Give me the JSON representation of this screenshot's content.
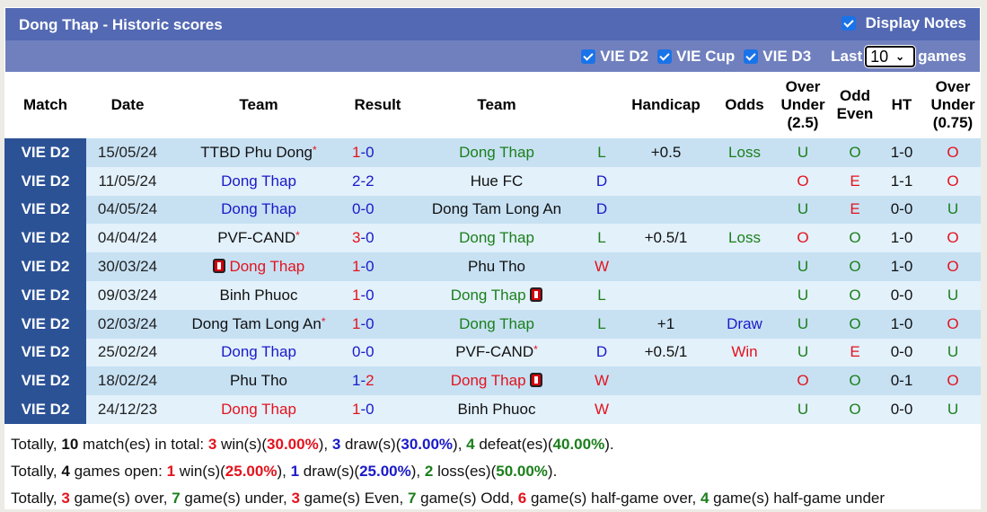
{
  "header": {
    "title": "Dong Thap - Historic scores",
    "display_notes_label": "Display Notes",
    "display_notes_checked": true
  },
  "filters": {
    "items": [
      {
        "label": "VIE D2",
        "checked": true
      },
      {
        "label": "VIE Cup",
        "checked": true
      },
      {
        "label": "VIE D3",
        "checked": true
      }
    ],
    "last_label": "Last",
    "games_count": "10",
    "games_label": "games"
  },
  "table": {
    "columns": [
      "Match",
      "Date",
      "Team",
      "Result",
      "Team",
      "",
      "Handicap",
      "Odds",
      "Over Under (2.5)",
      "Odd Even",
      "HT",
      "Over Under (0.75)"
    ],
    "column_lines": {
      "ou25": [
        "Over",
        "Under",
        "(2.5)"
      ],
      "oe": [
        "Odd",
        "Even"
      ],
      "ou075": [
        "Over",
        "Under",
        "(0.75)"
      ]
    },
    "rows": [
      {
        "match": "VIE D2",
        "date": "15/05/24",
        "home": "TTBD Phu Dong",
        "home_color": "dark",
        "home_star": true,
        "home_card": false,
        "score_home": "1",
        "score_away": "0",
        "sh_color": "red",
        "sa_color": "blue",
        "away": "Dong Thap",
        "away_color": "green",
        "away_star": false,
        "away_card": false,
        "wl": "L",
        "wl_color": "green",
        "handicap": "+0.5",
        "odds": "Loss",
        "odds_color": "green",
        "ou": "U",
        "ou_color": "green",
        "oe": "O",
        "oe_color": "green",
        "ht": "1-0",
        "ou075": "O",
        "ou075_color": "red"
      },
      {
        "match": "VIE D2",
        "date": "11/05/24",
        "home": "Dong Thap",
        "home_color": "blue",
        "home_star": false,
        "home_card": false,
        "score_home": "2",
        "score_away": "2",
        "sh_color": "blue",
        "sa_color": "blue",
        "away": "Hue FC",
        "away_color": "dark",
        "away_star": false,
        "away_card": false,
        "wl": "D",
        "wl_color": "blue",
        "handicap": "",
        "odds": "",
        "odds_color": "dark",
        "ou": "O",
        "ou_color": "red",
        "oe": "E",
        "oe_color": "red",
        "ht": "1-1",
        "ou075": "O",
        "ou075_color": "red"
      },
      {
        "match": "VIE D2",
        "date": "04/05/24",
        "home": "Dong Thap",
        "home_color": "blue",
        "home_star": false,
        "home_card": false,
        "score_home": "0",
        "score_away": "0",
        "sh_color": "blue",
        "sa_color": "blue",
        "away": "Dong Tam Long An",
        "away_color": "dark",
        "away_star": false,
        "away_card": false,
        "wl": "D",
        "wl_color": "blue",
        "handicap": "",
        "odds": "",
        "odds_color": "dark",
        "ou": "U",
        "ou_color": "green",
        "oe": "E",
        "oe_color": "red",
        "ht": "0-0",
        "ou075": "U",
        "ou075_color": "green"
      },
      {
        "match": "VIE D2",
        "date": "04/04/24",
        "home": "PVF-CAND",
        "home_color": "dark",
        "home_star": true,
        "home_card": false,
        "score_home": "3",
        "score_away": "0",
        "sh_color": "red",
        "sa_color": "blue",
        "away": "Dong Thap",
        "away_color": "green",
        "away_star": false,
        "away_card": false,
        "wl": "L",
        "wl_color": "green",
        "handicap": "+0.5/1",
        "odds": "Loss",
        "odds_color": "green",
        "ou": "O",
        "ou_color": "red",
        "oe": "O",
        "oe_color": "green",
        "ht": "1-0",
        "ou075": "O",
        "ou075_color": "red"
      },
      {
        "match": "VIE D2",
        "date": "30/03/24",
        "home": "Dong Thap",
        "home_color": "red",
        "home_star": false,
        "home_card": true,
        "score_home": "1",
        "score_away": "0",
        "sh_color": "red",
        "sa_color": "blue",
        "away": "Phu Tho",
        "away_color": "dark",
        "away_star": false,
        "away_card": false,
        "wl": "W",
        "wl_color": "red",
        "handicap": "",
        "odds": "",
        "odds_color": "dark",
        "ou": "U",
        "ou_color": "green",
        "oe": "O",
        "oe_color": "green",
        "ht": "1-0",
        "ou075": "O",
        "ou075_color": "red"
      },
      {
        "match": "VIE D2",
        "date": "09/03/24",
        "home": "Binh Phuoc",
        "home_color": "dark",
        "home_star": false,
        "home_card": false,
        "score_home": "1",
        "score_away": "0",
        "sh_color": "red",
        "sa_color": "blue",
        "away": "Dong Thap",
        "away_color": "green",
        "away_star": false,
        "away_card": true,
        "wl": "L",
        "wl_color": "green",
        "handicap": "",
        "odds": "",
        "odds_color": "dark",
        "ou": "U",
        "ou_color": "green",
        "oe": "O",
        "oe_color": "green",
        "ht": "0-0",
        "ou075": "U",
        "ou075_color": "green"
      },
      {
        "match": "VIE D2",
        "date": "02/03/24",
        "home": "Dong Tam Long An",
        "home_color": "dark",
        "home_star": true,
        "home_card": false,
        "score_home": "1",
        "score_away": "0",
        "sh_color": "red",
        "sa_color": "blue",
        "away": "Dong Thap",
        "away_color": "green",
        "away_star": false,
        "away_card": false,
        "wl": "L",
        "wl_color": "green",
        "handicap": "+1",
        "odds": "Draw",
        "odds_color": "blue",
        "ou": "U",
        "ou_color": "green",
        "oe": "O",
        "oe_color": "green",
        "ht": "1-0",
        "ou075": "O",
        "ou075_color": "red"
      },
      {
        "match": "VIE D2",
        "date": "25/02/24",
        "home": "Dong Thap",
        "home_color": "blue",
        "home_star": false,
        "home_card": false,
        "score_home": "0",
        "score_away": "0",
        "sh_color": "blue",
        "sa_color": "blue",
        "away": "PVF-CAND",
        "away_color": "dark",
        "away_star": true,
        "away_card": false,
        "wl": "D",
        "wl_color": "blue",
        "handicap": "+0.5/1",
        "odds": "Win",
        "odds_color": "red",
        "ou": "U",
        "ou_color": "green",
        "oe": "E",
        "oe_color": "red",
        "ht": "0-0",
        "ou075": "U",
        "ou075_color": "green"
      },
      {
        "match": "VIE D2",
        "date": "18/02/24",
        "home": "Phu Tho",
        "home_color": "dark",
        "home_star": false,
        "home_card": false,
        "score_home": "1",
        "score_away": "2",
        "sh_color": "blue",
        "sa_color": "red",
        "away": "Dong Thap",
        "away_color": "red",
        "away_star": false,
        "away_card": true,
        "wl": "W",
        "wl_color": "red",
        "handicap": "",
        "odds": "",
        "odds_color": "dark",
        "ou": "O",
        "ou_color": "red",
        "oe": "O",
        "oe_color": "green",
        "ht": "0-1",
        "ou075": "O",
        "ou075_color": "red"
      },
      {
        "match": "VIE D2",
        "date": "24/12/23",
        "home": "Dong Thap",
        "home_color": "red",
        "home_star": false,
        "home_card": false,
        "score_home": "1",
        "score_away": "0",
        "sh_color": "red",
        "sa_color": "blue",
        "away": "Binh Phuoc",
        "away_color": "dark",
        "away_star": false,
        "away_card": false,
        "wl": "W",
        "wl_color": "red",
        "handicap": "",
        "odds": "",
        "odds_color": "dark",
        "ou": "U",
        "ou_color": "green",
        "oe": "O",
        "oe_color": "green",
        "ht": "0-0",
        "ou075": "U",
        "ou075_color": "green"
      }
    ]
  },
  "summary": {
    "lines": [
      [
        {
          "t": "Totally, "
        },
        {
          "t": "10",
          "c": "dark",
          "b": true
        },
        {
          "t": " match(es) in total: "
        },
        {
          "t": "3",
          "c": "red",
          "b": true
        },
        {
          "t": " win(s)("
        },
        {
          "t": "30.00%",
          "c": "red",
          "b": true
        },
        {
          "t": "), "
        },
        {
          "t": "3",
          "c": "blue",
          "b": true
        },
        {
          "t": " draw(s)("
        },
        {
          "t": "30.00%",
          "c": "blue",
          "b": true
        },
        {
          "t": "), "
        },
        {
          "t": "4",
          "c": "green",
          "b": true
        },
        {
          "t": " defeat(es)("
        },
        {
          "t": "40.00%",
          "c": "green",
          "b": true
        },
        {
          "t": ")."
        }
      ],
      [
        {
          "t": "Totally, "
        },
        {
          "t": "4",
          "c": "dark",
          "b": true
        },
        {
          "t": " games open: "
        },
        {
          "t": "1",
          "c": "red",
          "b": true
        },
        {
          "t": " win(s)("
        },
        {
          "t": "25.00%",
          "c": "red",
          "b": true
        },
        {
          "t": "), "
        },
        {
          "t": "1",
          "c": "blue",
          "b": true
        },
        {
          "t": " draw(s)("
        },
        {
          "t": "25.00%",
          "c": "blue",
          "b": true
        },
        {
          "t": "), "
        },
        {
          "t": "2",
          "c": "green",
          "b": true
        },
        {
          "t": " loss(es)("
        },
        {
          "t": "50.00%",
          "c": "green",
          "b": true
        },
        {
          "t": ")."
        }
      ],
      [
        {
          "t": "Totally, "
        },
        {
          "t": "3",
          "c": "red",
          "b": true
        },
        {
          "t": " game(s) over, "
        },
        {
          "t": "7",
          "c": "green",
          "b": true
        },
        {
          "t": " game(s) under, "
        },
        {
          "t": "3",
          "c": "red",
          "b": true
        },
        {
          "t": " game(s) Even, "
        },
        {
          "t": "7",
          "c": "green",
          "b": true
        },
        {
          "t": " game(s) Odd, "
        },
        {
          "t": "6",
          "c": "red",
          "b": true
        },
        {
          "t": " game(s) half-game over, "
        },
        {
          "t": "4",
          "c": "green",
          "b": true
        },
        {
          "t": " game(s) half-game under"
        }
      ]
    ]
  }
}
